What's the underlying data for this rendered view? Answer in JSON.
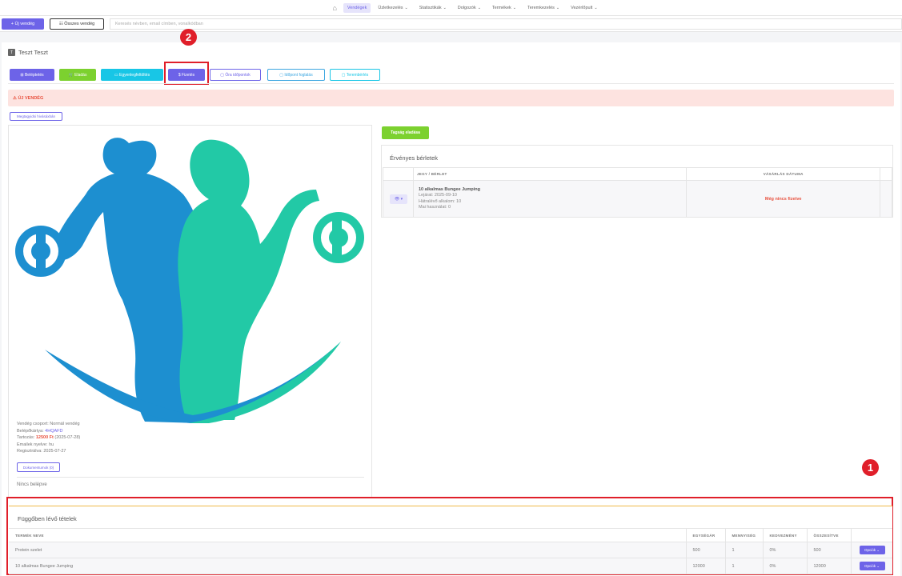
{
  "nav": {
    "home_icon": "home-icon",
    "items": [
      {
        "label": "Vendégek",
        "caret": ""
      },
      {
        "label": "Üzletkezelés",
        "caret": "⌄"
      },
      {
        "label": "Statisztikák",
        "caret": "⌄"
      },
      {
        "label": "Dolgozók",
        "caret": "⌄"
      },
      {
        "label": "Termékek",
        "caret": "⌄"
      },
      {
        "label": "Teremkezelés",
        "caret": "⌄"
      },
      {
        "label": "Vezérlőpult",
        "caret": "⌄"
      }
    ],
    "active": "Vendégek"
  },
  "search": {
    "new_guest": "+ Új vendég",
    "all_guests": "☷ Összes vendég",
    "placeholder": "Keresés névben, email címben, vonalkódban"
  },
  "guest": {
    "initial": "T",
    "name": "Teszt Teszt"
  },
  "actions": {
    "checkin": "⊞ Beléptetés",
    "sell": "🛒 Eladás",
    "balance": "▭ Egyenlegfeltöltés",
    "payment": "$ Fizetés",
    "class_times": "▢ Óra időpontok",
    "booking": "▢ Időpont foglalás",
    "room_rental": "▢ Terembérlés"
  },
  "annotations": {
    "one": "1",
    "two": "2"
  },
  "alert": "⚠ ÚJ VENDÉG",
  "history_btn": "Megtagyidsi hivásáxbán",
  "profile": {
    "group_label": "Vendég csoport:",
    "group_value": "Normál vendég",
    "card_label": "Belépőkártya:",
    "card_value": "4HQAFD",
    "debt_label": "Tartozás:",
    "debt_value": "12500 Ft",
    "debt_date": "(2025-07-28)",
    "lang_label": "Emailek nyelve:",
    "lang_value": "hu",
    "reg_label": "Regisztrálva:",
    "reg_value": "2025-07-27",
    "documents_btn": "Dokumentumok (0)",
    "no_checkin": "Nincs belépve"
  },
  "membership": {
    "add_btn": "Tagság eladása",
    "title": "Érvényes bérletek",
    "col_ticket": "JEGY / BÉRLET",
    "col_date": "VÁSÁRLÁS DÁTUMA",
    "row": {
      "eye": "👁 ▾",
      "name": "10 alkalmas Bungee Jumping",
      "expiry": "Lejárat: 2025-09-10",
      "remaining": "Hátralévő alkalom: 10",
      "today": "Mai használat: 0",
      "status": "Még nincs fizetve"
    }
  },
  "pending": {
    "title": "Függőben lévő tételek",
    "columns": [
      "TERMÉK NEVE",
      "EGYSÉGÁR",
      "MENNYISÉG",
      "KEDVEZMÉNY",
      "ÖSSZESÍTVE",
      ""
    ],
    "rows": [
      {
        "name": "Protein szelet",
        "price": "500",
        "qty": "1",
        "discount": "0%",
        "total": "500",
        "action": "Opciók ⌄"
      },
      {
        "name": "10 alkalmas Bungee Jumping",
        "price": "12000",
        "qty": "1",
        "discount": "0%",
        "total": "12000",
        "action": "Opciók ⌄"
      }
    ]
  },
  "colors": {
    "accent": "#6d63e8",
    "green": "#7cd12f",
    "cyan": "#18c6e6",
    "danger": "#e01f2a",
    "man": "#1d8fd0",
    "woman": "#22c9a6"
  }
}
